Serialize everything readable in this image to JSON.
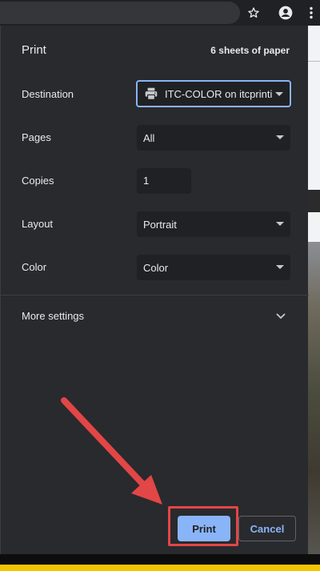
{
  "browser": {
    "icons": [
      "star-icon",
      "account-icon",
      "menu-dots-icon"
    ]
  },
  "dialog": {
    "title": "Print",
    "sheets": "6 sheets of paper",
    "destination": {
      "label": "Destination",
      "value": "ITC-COLOR on itcprinti",
      "icon": "printer-icon"
    },
    "pages": {
      "label": "Pages",
      "value": "All"
    },
    "copies": {
      "label": "Copies",
      "value": "1"
    },
    "layout": {
      "label": "Layout",
      "value": "Portrait"
    },
    "color": {
      "label": "Color",
      "value": "Color"
    },
    "more_settings": "More settings",
    "print_button": "Print",
    "cancel_button": "Cancel"
  },
  "colors": {
    "dialog_bg": "#292a2d",
    "accent": "#8ab4f8",
    "annotation_red": "#e24646",
    "bottom_yellow": "#f5c400"
  }
}
